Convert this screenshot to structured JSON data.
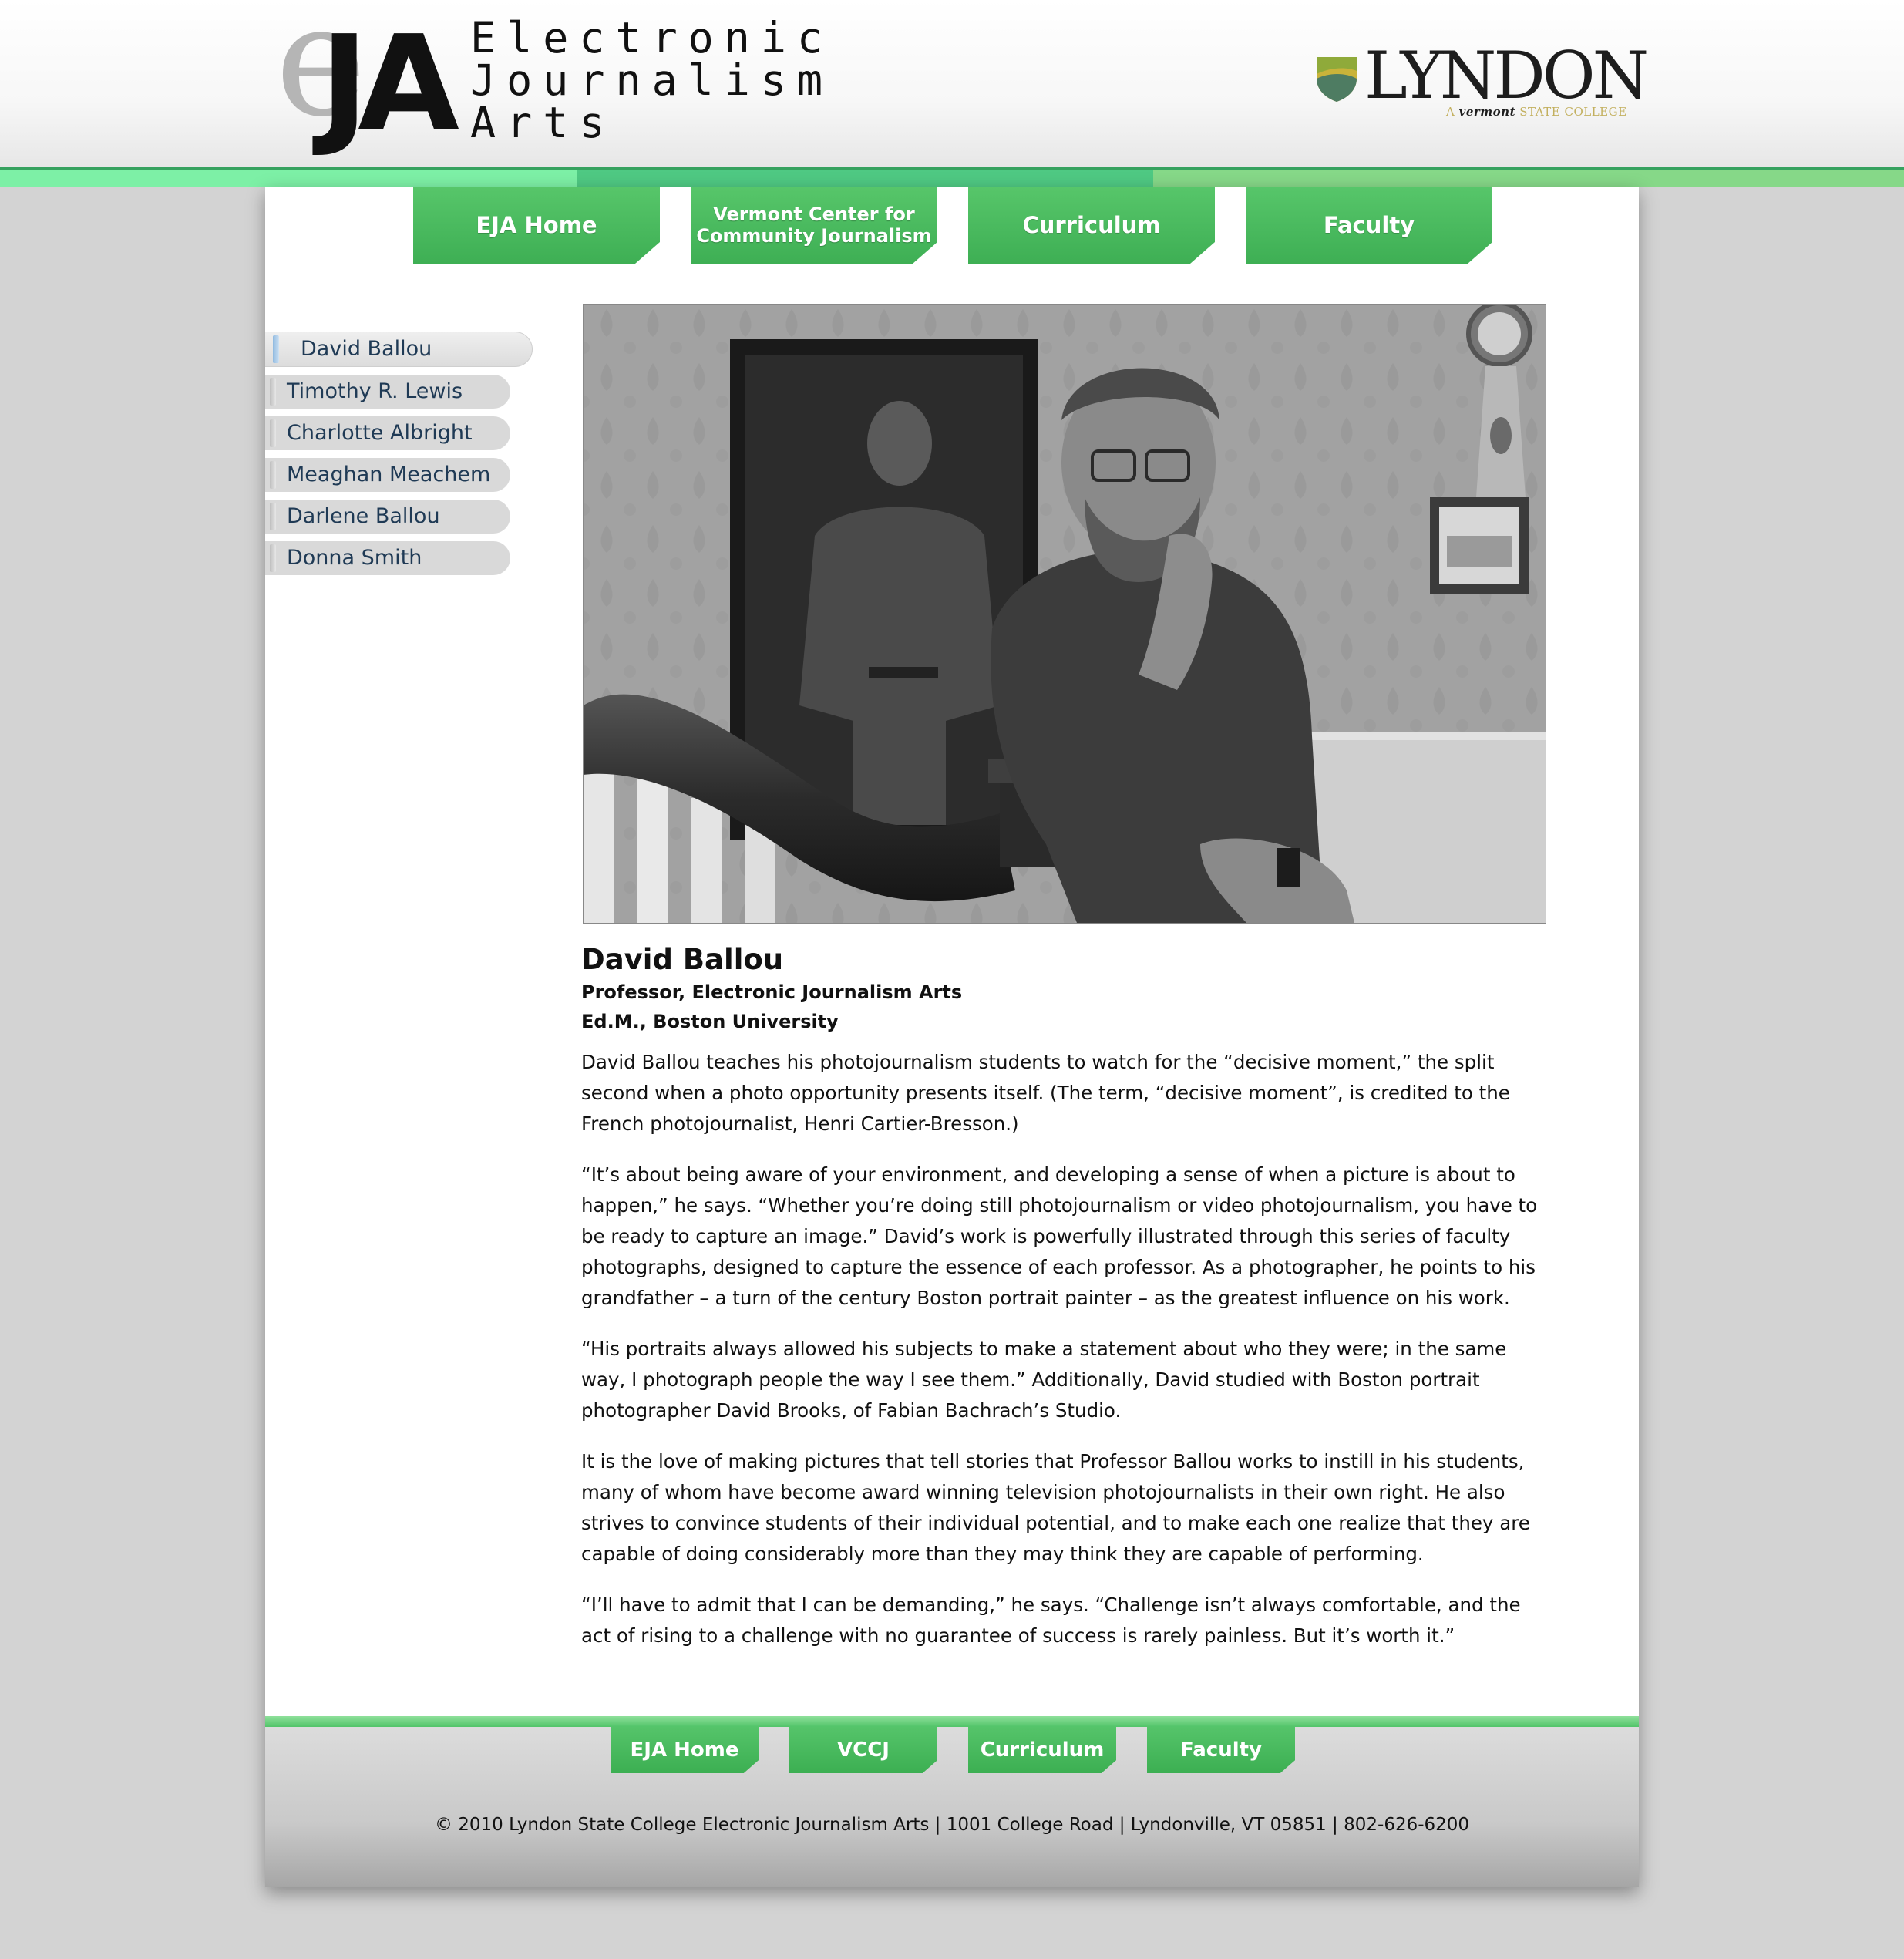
{
  "header": {
    "eja_logo_mark": "eJA",
    "eja_logo_lines": [
      "Electronic",
      "Journalism",
      "Arts"
    ],
    "lyndon_logo_word": "LYNDON",
    "lyndon_tagline_prefix": "A",
    "lyndon_tagline_state": "vermont",
    "lyndon_tagline_suffix": "STATE COLLEGE"
  },
  "nav": {
    "tabs": [
      {
        "label": "EJA Home"
      },
      {
        "label": "Vermont Center for Community Journalism"
      },
      {
        "label": "Curriculum"
      },
      {
        "label": "Faculty"
      }
    ]
  },
  "sidebar": {
    "items": [
      {
        "label": "David Ballou",
        "active": true
      },
      {
        "label": "Timothy R. Lewis"
      },
      {
        "label": "Charlotte Albright"
      },
      {
        "label": "Meaghan Meachem"
      },
      {
        "label": "Darlene Ballou"
      },
      {
        "label": "Donna Smith"
      }
    ]
  },
  "profile": {
    "name": "David Ballou",
    "title": "Professor, Electronic Journalism Arts",
    "degree": "Ed.M., Boston University",
    "paragraphs": [
      "David Ballou teaches his photojournalism students to watch for the “decisive moment,” the split second when a photo opportunity presents itself. (The term, “decisive moment”, is credited to the French photojournalist, Henri Cartier-Bresson.)",
      "“It’s about being aware of your environment, and developing a sense of when a picture is about to happen,” he says. “Whether you’re doing still photojournalism or video photojournalism, you have to be ready to capture an image.” David’s work is powerfully illustrated through this series of faculty photographs, designed to capture the essence of each professor. As a photographer, he points to his grandfather – a turn of the century Boston portrait painter – as the greatest influence on his work.",
      "“His portraits always allowed his subjects to make a statement about who they were; in the same way, I photograph people the way I see them.” Additionally, David studied with Boston portrait photographer David Brooks, of Fabian Bachrach’s Studio.",
      "It is the love of making pictures that tell stories that Professor Ballou works to instill in his students, many of whom have become award winning television photojournalists in their own right. He also strives to convince students of their individual potential, and to make each one realize that they are capable of doing considerably more than they may think they are capable of performing.",
      "“I’ll have to admit that I can be demanding,” he says. “Challenge isn’t always comfortable, and the act of rising to a challenge with no guarantee of success is rarely painless. But it’s worth it.”"
    ]
  },
  "footer": {
    "tabs": [
      {
        "label": "EJA Home"
      },
      {
        "label": "VCCJ"
      },
      {
        "label": "Curriculum"
      },
      {
        "label": "Faculty"
      }
    ],
    "copyright": "© 2010 Lyndon State College Electronic Journalism Arts | 1001 College Road | Lyndonville, VT 05851 | 802-626-6200"
  },
  "colors": {
    "nav_green": "#3eaf54",
    "stripe_light": "#7df0a6",
    "stripe_mid": "#4fc983",
    "stripe_right": "#86d888",
    "background": "#d3d3d3",
    "sidebar_text": "#1f3a55"
  }
}
